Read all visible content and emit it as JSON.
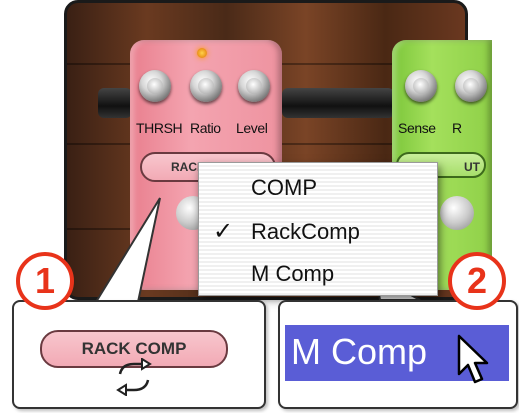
{
  "pedal_left": {
    "knob_labels": [
      "THRSH",
      "Ratio",
      "Level"
    ],
    "switch_label": "RACK COMP"
  },
  "pedal_right": {
    "knob_labels": [
      "Sense",
      "R"
    ],
    "switch_label": "UT"
  },
  "menu": {
    "items": [
      {
        "label": "COMP",
        "checked": false
      },
      {
        "label": "RackComp",
        "checked": true
      },
      {
        "label": "M Comp",
        "checked": false
      }
    ],
    "check_glyph": "✓"
  },
  "callout1": {
    "badge": "1",
    "button_label": "RACK COMP"
  },
  "callout2": {
    "badge": "2",
    "selected_label": "M Comp"
  },
  "colors": {
    "badge": "#e8331a",
    "highlight": "#5a5dd6",
    "pink_pedal": "#f4a4b0",
    "green_pedal": "#a4e05c"
  }
}
